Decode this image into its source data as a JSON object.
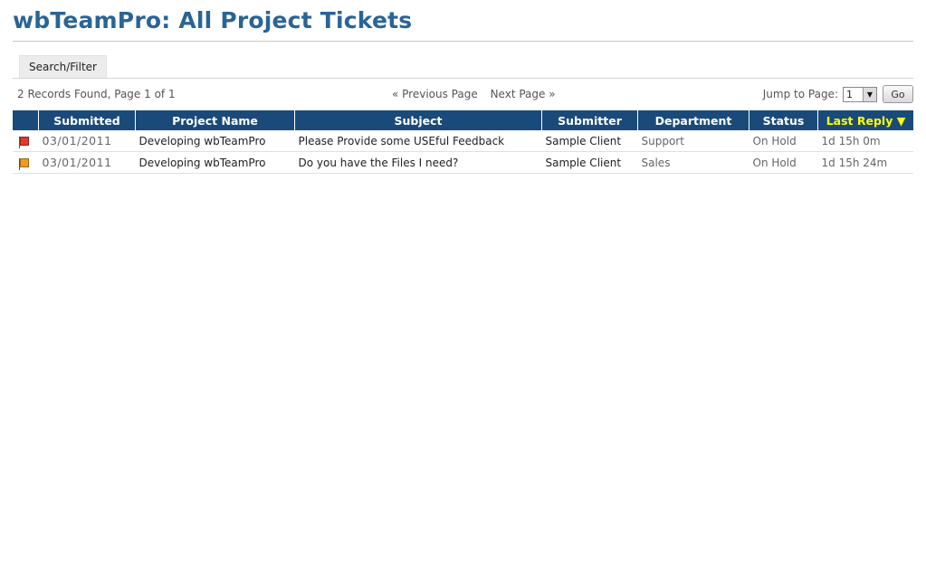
{
  "header": {
    "title": "wbTeamPro: All Project Tickets"
  },
  "toolbar": {
    "search_filter_label": "Search/Filter"
  },
  "summary": {
    "records_text": "2 Records Found, Page 1 of 1"
  },
  "pager": {
    "previous_label": "« Previous Page",
    "next_label": "Next Page »"
  },
  "jump": {
    "label": "Jump to Page:",
    "selected_page": "1",
    "go_label": "Go"
  },
  "table": {
    "columns": [
      "Submitted",
      "Project Name",
      "Subject",
      "Submitter",
      "Department",
      "Status",
      "Last Reply ▼"
    ],
    "sorted_column": "Last Reply",
    "rows": [
      {
        "flag_color": "#e03a2e",
        "submitted": "03/01/2011",
        "project": "Developing wbTeamPro",
        "subject": "Please Provide some USEful Feedback",
        "submitter": "Sample Client",
        "department": "Support",
        "status": "On Hold",
        "last_reply": "1d 15h 0m"
      },
      {
        "flag_color": "#f29a1e",
        "submitted": "03/01/2011",
        "project": "Developing wbTeamPro",
        "subject": "Do you have the Files I need?",
        "submitter": "Sample Client",
        "department": "Sales",
        "status": "On Hold",
        "last_reply": "1d 15h 24m"
      }
    ]
  },
  "colors": {
    "header_bg": "#1a4a7a",
    "title": "#2a6496",
    "active_sort": "#ffff00"
  }
}
